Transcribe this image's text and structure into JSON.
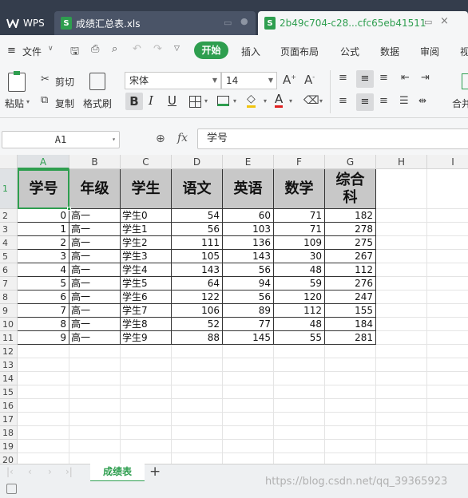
{
  "tabs": [
    {
      "label": "WPS"
    },
    {
      "label": "成绩汇总表.xls"
    },
    {
      "label": "2b49c704-c28...cfc65eb41511"
    }
  ],
  "menu": {
    "file": "文件",
    "items": [
      "开始",
      "插入",
      "页面布局",
      "公式",
      "数据",
      "审阅",
      "视"
    ]
  },
  "ribbon": {
    "paste": "粘贴",
    "cut": "剪切",
    "copy": "复制",
    "format_painter": "格式刷",
    "font_name": "宋体",
    "font_size": "14",
    "merge": "合并"
  },
  "formula_bar": {
    "cell_ref": "A1",
    "fx": "fx",
    "content": "学号"
  },
  "sheet": {
    "columns": [
      "A",
      "B",
      "C",
      "D",
      "E",
      "F",
      "G",
      "H",
      "I"
    ],
    "row_numbers": [
      "1",
      "2",
      "3",
      "4",
      "5",
      "6",
      "7",
      "8",
      "9",
      "10",
      "11",
      "12",
      "13",
      "14",
      "15",
      "16",
      "17",
      "18",
      "19",
      "20"
    ],
    "headers": [
      "学号",
      "年级",
      "学生",
      "语文",
      "英语",
      "数学",
      "综合\n科"
    ],
    "rows": [
      [
        "0",
        "高一",
        "学生0",
        "54",
        "60",
        "71",
        "182"
      ],
      [
        "1",
        "高一",
        "学生1",
        "56",
        "103",
        "71",
        "278"
      ],
      [
        "2",
        "高一",
        "学生2",
        "111",
        "136",
        "109",
        "275"
      ],
      [
        "3",
        "高一",
        "学生3",
        "105",
        "143",
        "30",
        "267"
      ],
      [
        "4",
        "高一",
        "学生4",
        "143",
        "56",
        "48",
        "112"
      ],
      [
        "5",
        "高一",
        "学生5",
        "64",
        "94",
        "59",
        "276"
      ],
      [
        "6",
        "高一",
        "学生6",
        "122",
        "56",
        "120",
        "247"
      ],
      [
        "7",
        "高一",
        "学生7",
        "106",
        "89",
        "112",
        "155"
      ],
      [
        "8",
        "高一",
        "学生8",
        "52",
        "77",
        "48",
        "184"
      ],
      [
        "9",
        "高一",
        "学生9",
        "88",
        "145",
        "55",
        "281"
      ]
    ]
  },
  "sheet_tabs": {
    "active": "成绩表",
    "add": "+"
  },
  "watermark": "https://blog.csdn.net/qq_39365923",
  "colors": {
    "accent": "#2e9e4f",
    "tabbar": "#343d4c",
    "header_fill": "#c8c8c8"
  }
}
